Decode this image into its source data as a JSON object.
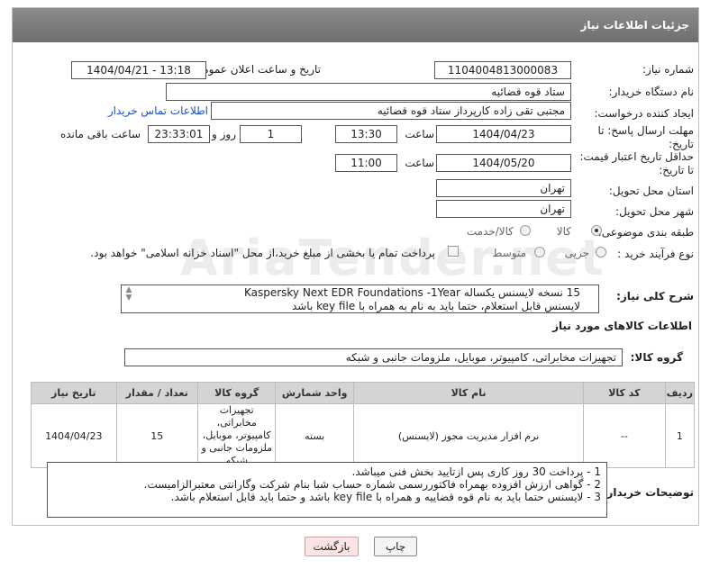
{
  "header": {
    "title": "جزئیات اطلاعات نیاز"
  },
  "fields": {
    "need_number_label": "شماره نیاز:",
    "need_number": "1104004813000083",
    "announce_label": "تاریخ و ساعت اعلان عمومی:",
    "announce_value": "1404/04/21 - 13:18",
    "buyer_org_label": "نام دستگاه خریدار:",
    "buyer_org": "ستاد قوه قضائیه",
    "creator_label": "ایجاد کننده درخواست:",
    "creator": "مجتبی تقی زاده کارپرداز ستاد قوه قضائیه",
    "buyer_contact_link": "اطلاعات تماس خریدار",
    "reply_deadline_label": "مهلت ارسال پاسخ: تا تاریخ:",
    "reply_date": "1404/04/23",
    "time_label": "ساعت",
    "reply_time": "13:30",
    "days_value": "1",
    "days_label": "روز و",
    "remaining_time": "23:33:01",
    "remaining_label": "ساعت باقی مانده",
    "price_validity_label": "حداقل تاریخ اعتبار قیمت: تا تاریخ:",
    "price_date": "1404/05/20",
    "price_time": "11:00",
    "province_label": "استان محل تحویل:",
    "province": "تهران",
    "city_label": "شهر محل تحویل:",
    "city": "تهران",
    "category_label": "طبقه بندی موضوعی:",
    "category_options": [
      "کالا",
      "کالا/خدمت"
    ],
    "process_label": "نوع فرآیند خرید :",
    "process_options": [
      "جزیی",
      "متوسط"
    ],
    "payment_note": "پرداخت تمام یا بخشی از مبلغ خرید،از محل \"اسناد خزانه اسلامی\" خواهد بود.",
    "desc_label": "شرح کلی نیاز:",
    "desc_line1": "15 نسخه لایسنس یکساله Kaspersky Next  EDR Foundations -1Year",
    "desc_line2": "لایسنس قابل استعلام، حتما باید به نام به همراه با key file باشد",
    "items_title": "اطلاعات کالاهای مورد نیاز",
    "goods_group_label": "گروه کالا:",
    "goods_group": "تجهیزات مخابراتی، کامپیوتر، موبایل، ملزومات جانبی و شبکه"
  },
  "table": {
    "headers": [
      "ردیف",
      "کد کالا",
      "نام کالا",
      "واحد شمارش",
      "گروه کالا",
      "تعداد / مقدار",
      "تاریخ نیاز"
    ],
    "rows": [
      [
        "1",
        "--",
        "نرم افزار مدیریت مجوز (لایسنس)",
        "بسته",
        "تجهیزات مخابراتی، کامپیوتر، موبایل، ملزومات جانبی و شبکه",
        "15",
        "1404/04/23"
      ]
    ]
  },
  "notes": {
    "label": "توضیحات خریدار:",
    "lines": [
      "1 -  پرداخت 30 روز کاری پس ازتایید بخش فنی میباشد.",
      "2 - گواهی ارزش افزوده بهمراه فاکتوررسمی شماره حساب شبا بنام شرکت وگارانتی معتبرالزامیست.",
      "3 - لایسنس حتما باید به نام قوه قضاییه و همراه با key file باشد و حتما باید قابل استعلام باشد."
    ]
  },
  "buttons": {
    "print": "چاپ",
    "back": "بازگشت"
  },
  "watermark": "AriaTender.net",
  "colors": {
    "header_bg": "#7a7a7a",
    "link": "#1a4fd1",
    "back_btn_bg": "#fde4e4"
  }
}
